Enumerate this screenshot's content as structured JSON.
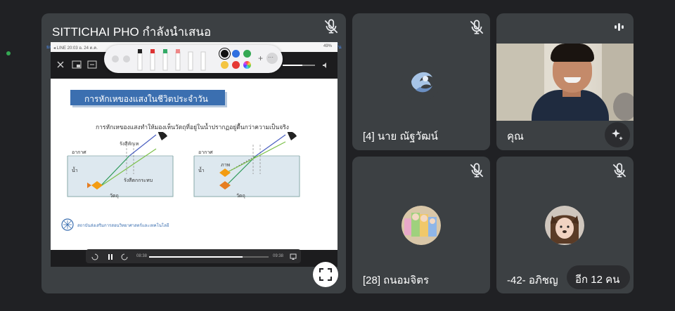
{
  "presenter": {
    "title": "SITTICHAI PHO กำลังนำเสนอ",
    "phone_left": "ยกเลิก",
    "phone_right": "เสร็จสิ้น",
    "status_left": "◂ LINE  20:03  อ. 24 ต.ค.",
    "status_right": "49%",
    "video_time_left": "08:38",
    "video_time_right": "09:38",
    "video_progress": 0.78
  },
  "slide": {
    "heading": "การหักเหของแสงในชีวิตประจำวัน",
    "subtitle": "การหักเหของแสงทำให้มองเห็นวัตถุที่อยู่ในน้ำปรากฏอยู่ตื้นกว่าความเป็นจริง",
    "left": {
      "air": "อากาศ",
      "water": "น้ำ",
      "refracted_ray": "รังสีหักเห",
      "incident_ray": "รังสีตกกระทบ",
      "object": "วัตถุ"
    },
    "right": {
      "air": "อากาศ",
      "water": "น้ำ",
      "image": "ภาพ",
      "object": "วัตถุ"
    },
    "footer": "สถาบันส่งเสริมการสอนวิทยาศาสตร์และเทคโนโลยี"
  },
  "toolbar": {
    "colors": [
      "#111111",
      "#2f6fe0",
      "#34a853",
      "#f4c542",
      "#e53935",
      "#a78bfa"
    ],
    "add_label": "+",
    "more_label": "···"
  },
  "participants": [
    {
      "name": "[4] นาย ณัฐวัฒน์"
    },
    {
      "name": "คุณ"
    },
    {
      "name": "[28] ถนอมจิตร"
    },
    {
      "name": "-42- อภิชญ"
    }
  ],
  "more_people": "อีก 12 คน",
  "colors": {
    "background": "#202124",
    "tile": "#3c4043",
    "slide_heading_bg": "#3b6fb0",
    "water": "#dde8ef",
    "green_dot": "#34a853"
  }
}
